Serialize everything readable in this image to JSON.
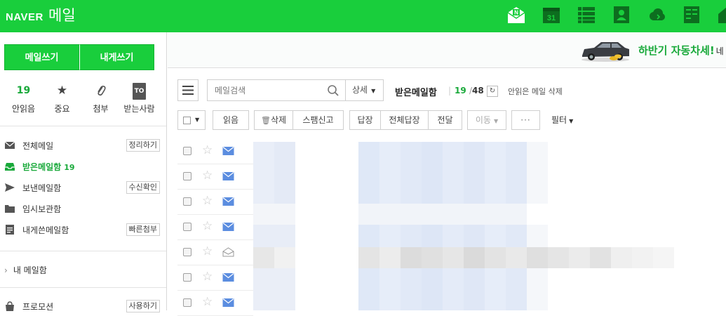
{
  "header": {
    "brand": "NAVER",
    "product": "메일",
    "icons": [
      "naver-mail-icon",
      "calendar-icon",
      "list-icon",
      "contacts-icon",
      "cloud-icon",
      "memo-icon",
      "home-icon"
    ],
    "calendar_day": "31"
  },
  "sidebar": {
    "write_mail": "메일쓰기",
    "write_self": "내게쓰기",
    "quick": [
      {
        "value": "19",
        "label": "안읽음"
      },
      {
        "icon": "star-icon",
        "label": "중요"
      },
      {
        "icon": "paperclip-icon",
        "label": "첨부"
      },
      {
        "badge": "TO",
        "label": "받는사람"
      }
    ],
    "folders": [
      {
        "name": "전체메일",
        "button": "정리하기",
        "icon": "envelope-icon"
      },
      {
        "name": "받은메일함",
        "count": "19",
        "active": true,
        "icon": "inbox-icon"
      },
      {
        "name": "보낸메일함",
        "button": "수신확인",
        "icon": "send-icon"
      },
      {
        "name": "임시보관함",
        "icon": "folder-icon"
      },
      {
        "name": "내게쓴메일함",
        "button": "빠른첨부",
        "icon": "note-icon"
      }
    ],
    "my_mailbox": "내 메일함",
    "promo": {
      "name": "프로모션",
      "button": "사용하기"
    }
  },
  "banner": {
    "text": "하반기 자동차세!",
    "tail": "네"
  },
  "toolbar": {
    "search_placeholder": "메일검색",
    "detail": "상세",
    "box_title": "받은메일함",
    "unread": "19",
    "total": "48",
    "delete_unread": "안읽은 메일 삭제",
    "read": "읽음",
    "delete": "삭제",
    "spam": "스팸신고",
    "reply": "답장",
    "reply_all": "전체답장",
    "forward": "전달",
    "move": "이동",
    "more": "···",
    "filter": "필터"
  },
  "mail_rows": [
    {
      "read": false
    },
    {
      "read": false
    },
    {
      "read": false
    },
    {
      "read": false
    },
    {
      "read": true
    },
    {
      "read": false
    },
    {
      "read": false
    }
  ],
  "colors": {
    "brand_green": "#19ce3c",
    "accent_text": "#19a93a"
  }
}
